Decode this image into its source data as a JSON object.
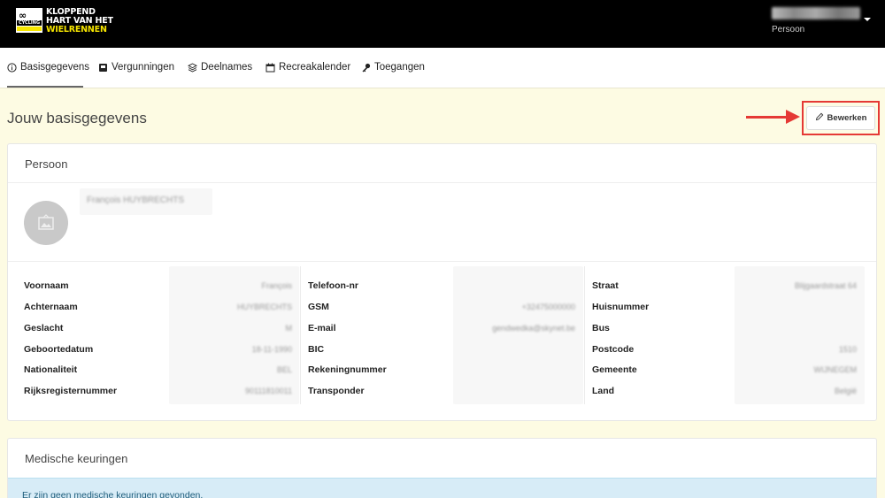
{
  "brand": {
    "line1": "KLOPPEND",
    "line2": "HART VAN HET",
    "line3": "WIELRENNEN",
    "mark_text": "CYCLING",
    "colors": {
      "yellow": "#f7e600",
      "black": "#000000"
    }
  },
  "user": {
    "role": "Persoon"
  },
  "tabs": [
    {
      "label": "Basisgegevens",
      "icon": "info-circle-icon",
      "active": true
    },
    {
      "label": "Vergunningen",
      "icon": "id-card-icon"
    },
    {
      "label": "Deelnames",
      "icon": "layers-icon"
    },
    {
      "label": "Recreakalender",
      "icon": "calendar-icon"
    },
    {
      "label": "Toegangen",
      "icon": "key-icon"
    }
  ],
  "page": {
    "title": "Jouw basisgegevens",
    "edit_label": "Bewerken",
    "highlight_color": "#e53935"
  },
  "person": {
    "card_title": "Persoon",
    "full_name": "François HUYBRECHTS",
    "fields_col1": [
      {
        "label": "Voornaam",
        "value": "François"
      },
      {
        "label": "Achternaam",
        "value": "HUYBRECHTS"
      },
      {
        "label": "Geslacht",
        "value": "M"
      },
      {
        "label": "Geboortedatum",
        "value": "18-11-1990"
      },
      {
        "label": "Nationaliteit",
        "value": "BEL"
      },
      {
        "label": "Rijksregisternummer",
        "value": "90111810011"
      }
    ],
    "fields_col2": [
      {
        "label": "Telefoon-nr",
        "value": ""
      },
      {
        "label": "GSM",
        "value": "+32475000000"
      },
      {
        "label": "E-mail",
        "value": "gendwedka@skynet.be"
      },
      {
        "label": "BIC",
        "value": ""
      },
      {
        "label": "Rekeningnummer",
        "value": ""
      },
      {
        "label": "Transponder",
        "value": ""
      }
    ],
    "fields_col3": [
      {
        "label": "Straat",
        "value": "Blijgaardstraat 64"
      },
      {
        "label": "Huisnummer",
        "value": ""
      },
      {
        "label": "Bus",
        "value": ""
      },
      {
        "label": "Postcode",
        "value": "1510"
      },
      {
        "label": "Gemeente",
        "value": "WIJNEGEM"
      },
      {
        "label": "Land",
        "value": "België"
      }
    ]
  },
  "medical": {
    "card_title": "Medische keuringen",
    "empty_message": "Er zijn geen medische keuringen gevonden."
  }
}
